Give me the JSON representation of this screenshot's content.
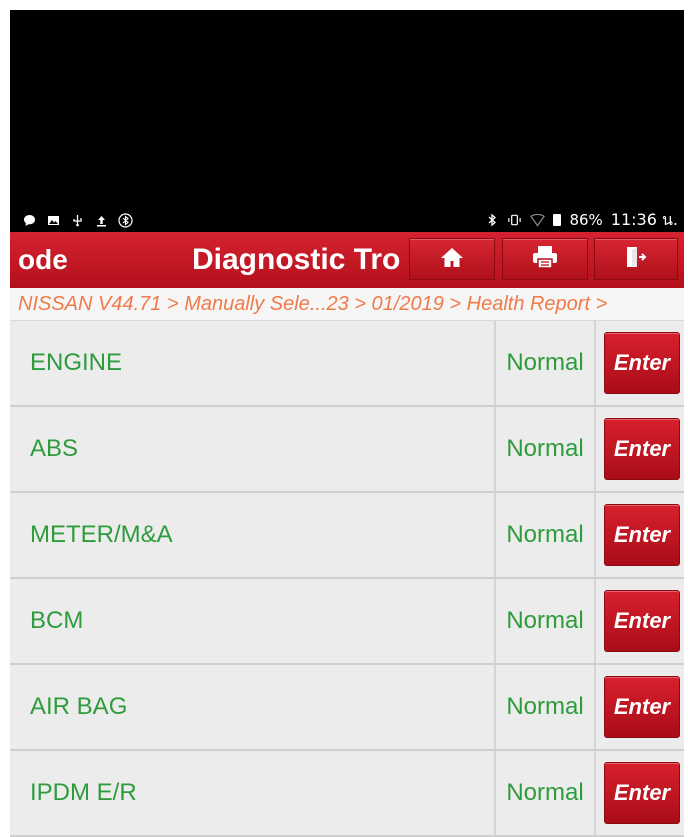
{
  "status_bar": {
    "battery": "86%",
    "time": "11:36 น.",
    "left_icons": [
      "chat-bubble-icon",
      "image-icon",
      "usb-icon",
      "upload-icon",
      "bluetooth-circle-icon"
    ],
    "right_icons": [
      "bluetooth-icon",
      "vibrate-icon",
      "wifi-icon",
      "battery-icon"
    ]
  },
  "title_bar": {
    "mode_text": "ode",
    "title": "Diagnostic Trouble Code",
    "buttons": [
      "home-icon",
      "print-icon",
      "exit-icon"
    ]
  },
  "breadcrumb": "NISSAN V44.71 > Manually Sele...23 > 01/2019 > Health Report >",
  "systems": [
    {
      "name": "ENGINE",
      "status": "Normal",
      "action": "Enter"
    },
    {
      "name": "ABS",
      "status": "Normal",
      "action": "Enter"
    },
    {
      "name": "METER/M&A",
      "status": "Normal",
      "action": "Enter"
    },
    {
      "name": "BCM",
      "status": "Normal",
      "action": "Enter"
    },
    {
      "name": "AIR BAG",
      "status": "Normal",
      "action": "Enter"
    },
    {
      "name": "IPDM E/R",
      "status": "Normal",
      "action": "Enter"
    }
  ],
  "colors": {
    "accent_red": "#c41722",
    "status_green": "#2e9c3c",
    "breadcrumb_orange": "#f07b4a"
  }
}
